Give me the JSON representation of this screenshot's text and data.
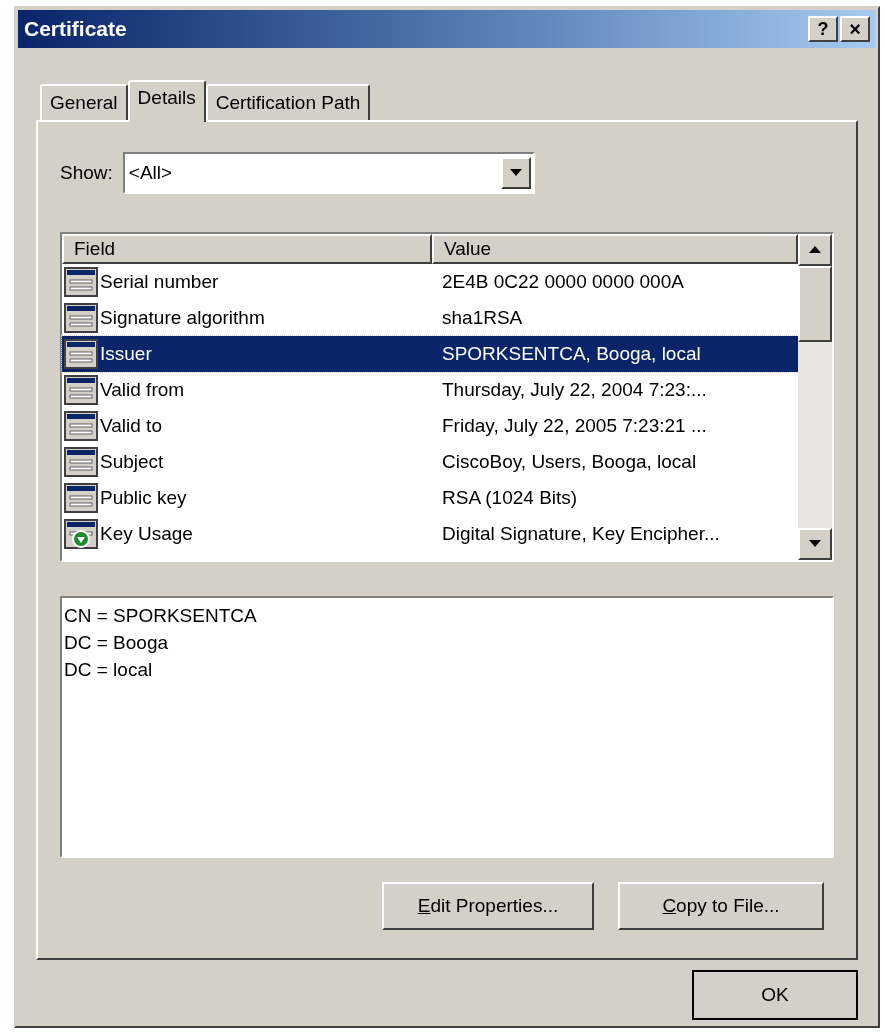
{
  "window": {
    "title": "Certificate",
    "help_button": "?",
    "close_button": "×"
  },
  "tabs": [
    {
      "label": "General",
      "selected": false
    },
    {
      "label": "Details",
      "selected": true
    },
    {
      "label": "Certification Path",
      "selected": false
    }
  ],
  "show": {
    "label": "Show:",
    "value": "<All>"
  },
  "table": {
    "columns": [
      "Field",
      "Value"
    ],
    "rows": [
      {
        "kind": "field",
        "field": "Serial number",
        "value": "2E4B 0C22 0000 0000 000A",
        "selected": false
      },
      {
        "kind": "field",
        "field": "Signature algorithm",
        "value": "sha1RSA",
        "selected": false
      },
      {
        "kind": "field",
        "field": "Issuer",
        "value": "SPORKSENTCA, Booga, local",
        "selected": true
      },
      {
        "kind": "field",
        "field": "Valid from",
        "value": "Thursday, July 22, 2004 7:23:...",
        "selected": false
      },
      {
        "kind": "field",
        "field": "Valid to",
        "value": "Friday, July 22, 2005 7:23:21 ...",
        "selected": false
      },
      {
        "kind": "field",
        "field": "Subject",
        "value": "CiscoBoy, Users, Booga, local",
        "selected": false
      },
      {
        "kind": "field",
        "field": "Public key",
        "value": "RSA (1024 Bits)",
        "selected": false
      },
      {
        "kind": "extension",
        "field": "Key Usage",
        "value": "Digital Signature, Key Encipher...",
        "selected": false
      }
    ]
  },
  "details": [
    "CN = SPORKSENTCA",
    "DC = Booga",
    "DC = local"
  ],
  "buttons": [
    {
      "label": "Edit Properties...",
      "accel_first": true
    },
    {
      "label": "Copy to File...",
      "accel_first": true
    }
  ],
  "ok_button": "OK"
}
